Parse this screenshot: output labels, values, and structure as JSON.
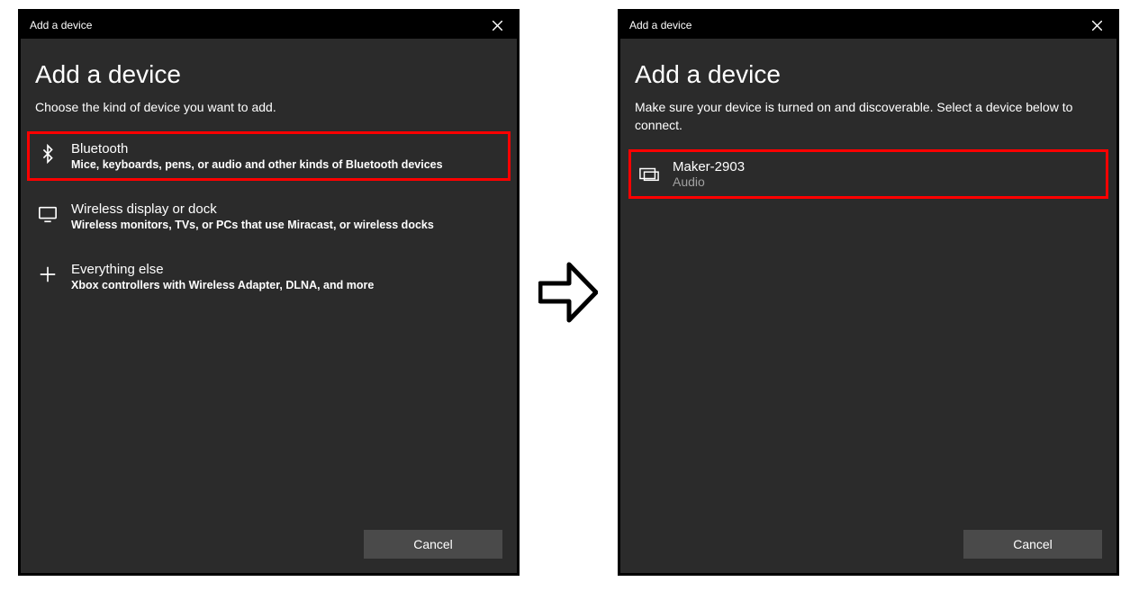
{
  "dialog1": {
    "titlebar": "Add a device",
    "heading": "Add a device",
    "subheading": "Choose the kind of device you want to add.",
    "options": [
      {
        "title": "Bluetooth",
        "sub": "Mice, keyboards, pens, or audio and other kinds of Bluetooth devices"
      },
      {
        "title": "Wireless display or dock",
        "sub": "Wireless monitors, TVs, or PCs that use Miracast, or wireless docks"
      },
      {
        "title": "Everything else",
        "sub": "Xbox controllers with Wireless Adapter, DLNA, and more"
      }
    ],
    "cancel": "Cancel"
  },
  "dialog2": {
    "titlebar": "Add a device",
    "heading": "Add a device",
    "subheading": "Make sure your device is turned on and discoverable. Select a device below to connect.",
    "device": {
      "name": "Maker-2903",
      "type": "Audio"
    },
    "cancel": "Cancel"
  }
}
